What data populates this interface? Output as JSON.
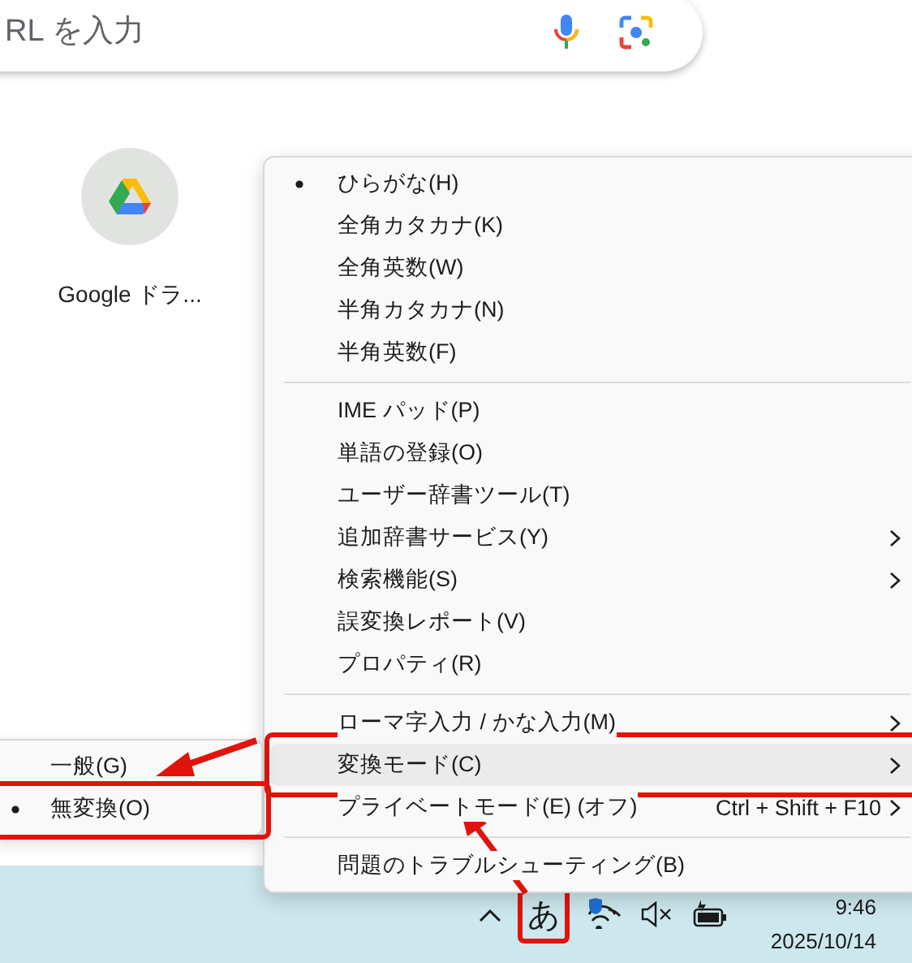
{
  "address_bar": {
    "placeholder": "RL を入力"
  },
  "shortcuts": [
    {
      "label": "Google ドラ..."
    }
  ],
  "ime_menu": {
    "groups": [
      [
        {
          "label": "ひらがな(H)",
          "selected": true,
          "has_submenu": false,
          "highlighted": false,
          "annotated": false
        },
        {
          "label": "全角カタカナ(K)",
          "selected": false,
          "has_submenu": false,
          "highlighted": false,
          "annotated": false
        },
        {
          "label": "全角英数(W)",
          "selected": false,
          "has_submenu": false,
          "highlighted": false,
          "annotated": false
        },
        {
          "label": "半角カタカナ(N)",
          "selected": false,
          "has_submenu": false,
          "highlighted": false,
          "annotated": false
        },
        {
          "label": "半角英数(F)",
          "selected": false,
          "has_submenu": false,
          "highlighted": false,
          "annotated": false
        }
      ],
      [
        {
          "label": "IME パッド(P)",
          "selected": false,
          "has_submenu": false,
          "highlighted": false,
          "annotated": false
        },
        {
          "label": "単語の登録(O)",
          "selected": false,
          "has_submenu": false,
          "highlighted": false,
          "annotated": false
        },
        {
          "label": "ユーザー辞書ツール(T)",
          "selected": false,
          "has_submenu": false,
          "highlighted": false,
          "annotated": false
        },
        {
          "label": "追加辞書サービス(Y)",
          "selected": false,
          "has_submenu": true,
          "highlighted": false,
          "annotated": false
        },
        {
          "label": "検索機能(S)",
          "selected": false,
          "has_submenu": true,
          "highlighted": false,
          "annotated": false
        },
        {
          "label": "誤変換レポート(V)",
          "selected": false,
          "has_submenu": false,
          "highlighted": false,
          "annotated": false
        },
        {
          "label": "プロパティ(R)",
          "selected": false,
          "has_submenu": false,
          "highlighted": false,
          "annotated": false
        }
      ],
      [
        {
          "label": "ローマ字入力 / かな入力(M)",
          "selected": false,
          "has_submenu": true,
          "highlighted": false,
          "annotated": false
        },
        {
          "label": "変換モード(C)",
          "selected": false,
          "has_submenu": true,
          "highlighted": true,
          "annotated": true
        },
        {
          "label": "プライベートモード(E) (オフ)",
          "shortcut": "Ctrl + Shift + F10",
          "selected": false,
          "has_submenu": true,
          "highlighted": false,
          "annotated": false
        }
      ],
      [
        {
          "label": "問題のトラブルシューティング(B)",
          "selected": false,
          "has_submenu": false,
          "highlighted": false,
          "annotated": false
        }
      ]
    ]
  },
  "submenu": {
    "items": [
      {
        "label": "一般(G)",
        "selected": false,
        "annotated": false
      },
      {
        "label": "無変換(O)",
        "selected": true,
        "annotated": true
      }
    ]
  },
  "annotation_arrows": true,
  "taskbar": {
    "ime_indicator": {
      "label": "あ",
      "annotated": true
    },
    "time": "9:46",
    "date": "2025/10/14"
  }
}
